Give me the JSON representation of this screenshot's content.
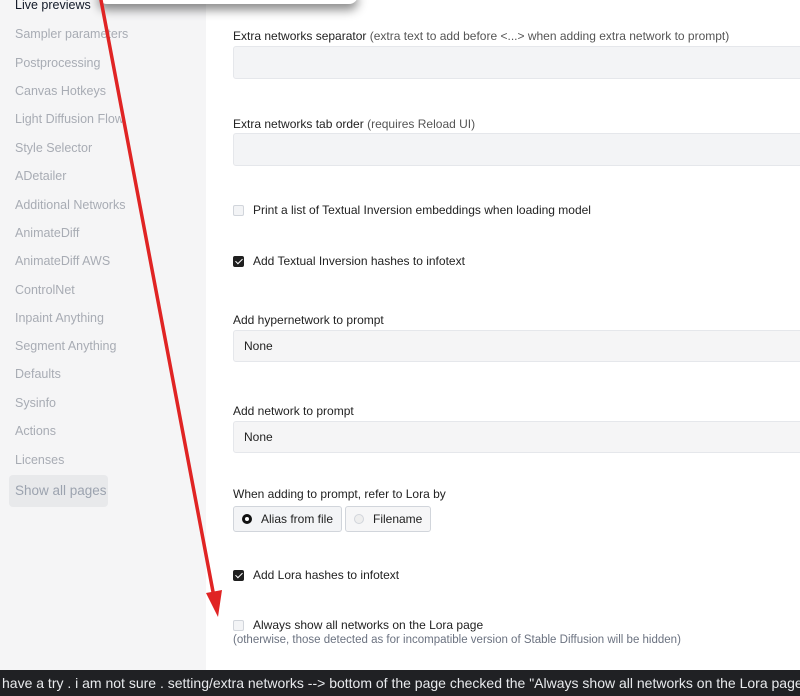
{
  "sidebar": {
    "items": [
      {
        "label": "Live previews",
        "active": true
      },
      {
        "label": "Sampler parameters"
      },
      {
        "label": "Postprocessing"
      },
      {
        "label": "Canvas Hotkeys"
      },
      {
        "label": "Light Diffusion Flow"
      },
      {
        "label": "Style Selector"
      },
      {
        "label": "ADetailer"
      },
      {
        "label": "Additional Networks"
      },
      {
        "label": "AnimateDiff"
      },
      {
        "label": "AnimateDiff AWS"
      },
      {
        "label": "ControlNet"
      },
      {
        "label": "Inpaint Anything"
      },
      {
        "label": "Segment Anything"
      },
      {
        "label": "Defaults"
      },
      {
        "label": "Sysinfo"
      },
      {
        "label": "Actions"
      },
      {
        "label": "Licenses"
      }
    ],
    "show_all": "Show all pages"
  },
  "settings": {
    "separator": {
      "label": "Extra networks separator",
      "hint": "(extra text to add before <...> when adding extra network to prompt)",
      "value": ""
    },
    "tab_order": {
      "label": "Extra networks tab order",
      "hint": "(requires Reload UI)",
      "value": ""
    },
    "print_ti": {
      "label": "Print a list of Textual Inversion embeddings when loading model",
      "checked": false
    },
    "ti_hashes": {
      "label": "Add Textual Inversion hashes to infotext",
      "checked": true
    },
    "hypernetwork": {
      "label": "Add hypernetwork to prompt",
      "value": "None"
    },
    "network": {
      "label": "Add network to prompt",
      "value": "None"
    },
    "lora_ref": {
      "label": "When adding to prompt, refer to Lora by",
      "options": [
        "Alias from file",
        "Filename"
      ],
      "selected": "Alias from file"
    },
    "lora_hashes": {
      "label": "Add Lora hashes to infotext",
      "checked": true
    },
    "show_all_networks": {
      "label": "Always show all networks on the Lora page",
      "checked": false,
      "hint": "(otherwise, those detected as for incompatible version of Stable Diffusion will be hidden)"
    }
  },
  "annotation": {
    "color": "#e02424"
  },
  "caption": "have a try . i am not sure . setting/extra networks --> bottom of the page checked the \"Always show all networks on the Lora page \""
}
